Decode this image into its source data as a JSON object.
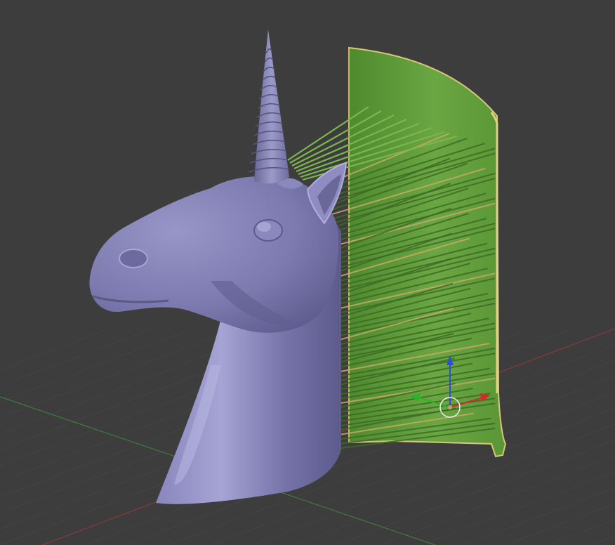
{
  "viewport": {
    "background": "#3d3d3d",
    "grid_color": "#474747",
    "axis_x_color": "#8a3a3a",
    "axis_y_color": "#3f7a3f"
  },
  "unicorn": {
    "color": "#7e7cb0",
    "highlight": "#a9a7d6",
    "shadow": "#5a5888"
  },
  "mane_panel": {
    "color": "#5c9638",
    "light": "#74ad48",
    "outline": "#d9c67a",
    "strand_color": "#3d6a25",
    "strand_highlight": "#c9a86a"
  },
  "gizmo": {
    "x_axis_color": "#d42a2a",
    "y_axis_color": "#27b427",
    "z_axis_color": "#2a4fd8",
    "ring_color": "#e8e8e8",
    "center_color": "#c9a060"
  }
}
